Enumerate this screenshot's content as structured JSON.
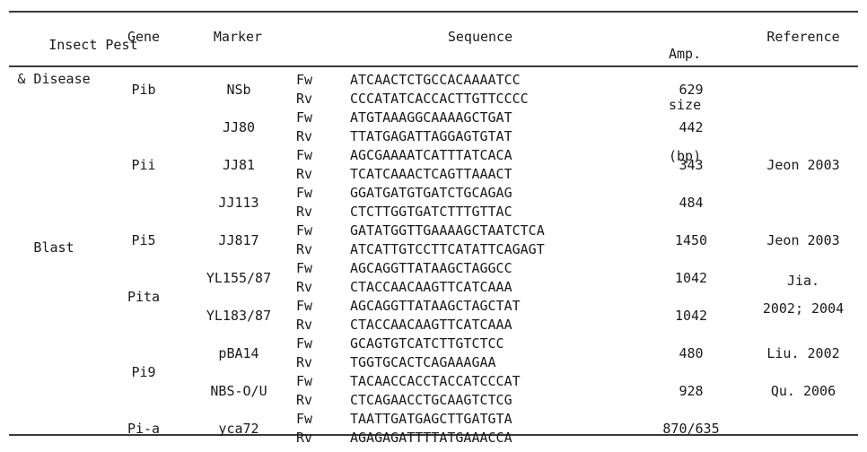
{
  "table": {
    "headers": {
      "pest_disease_line1": "Insect Pest",
      "pest_disease_line2": "& Disease",
      "gene": "Gene",
      "marker": "Marker",
      "sequence": "Sequence",
      "amp_size_line1": "Amp.",
      "amp_size_line2": "size",
      "amp_size_line3": "(bp)",
      "reference": "Reference"
    },
    "pest_disease": "Blast",
    "direction_labels": {
      "forward": "Fw",
      "reverse": "Rv"
    },
    "genes": [
      {
        "name": "Pib",
        "markers": [
          "NSb"
        ]
      },
      {
        "name": "Pii",
        "markers": [
          "JJ80",
          "JJ81",
          "JJ113"
        ]
      },
      {
        "name": "Pi5",
        "markers": [
          "JJ817"
        ]
      },
      {
        "name": "Pita",
        "markers": [
          "YL155/87",
          "YL183/87"
        ]
      },
      {
        "name": "Pi9",
        "markers": [
          "pBA14",
          "NBS-O/U"
        ]
      },
      {
        "name": "Pi-a",
        "markers": [
          "yca72"
        ]
      }
    ],
    "rows": [
      {
        "gene": "Pib",
        "marker": "NSb",
        "fw": "ATCAACTCTGCCACAAAATCC",
        "rv": "CCCATATCACCACTTGTTCCCC",
        "amp_size": "629",
        "reference": ""
      },
      {
        "gene": "Pii",
        "marker": "JJ80",
        "fw": "ATGTAAAGGCAAAAGCTGAT",
        "rv": "TTATGAGATTAGGAGTGTAT",
        "amp_size": "442",
        "reference": ""
      },
      {
        "gene": "Pii",
        "marker": "JJ81",
        "fw": "AGCGAAAATCATTTATCACA",
        "rv": "TCATCAAACTCAGTTAAACT",
        "amp_size": "343",
        "reference": "Jeon 2003"
      },
      {
        "gene": "Pii",
        "marker": "JJ113",
        "fw": "GGATGATGTGATCTGCAGAG",
        "rv": "CTCTTGGTGATCTTTGTTAC",
        "amp_size": "484",
        "reference": ""
      },
      {
        "gene": "Pi5",
        "marker": "JJ817",
        "fw": "GATATGGTTGAAAAGCTAATCTCA",
        "rv": "ATCATTGTCCTTCATATTCAGAGT",
        "amp_size": "1450",
        "reference": "Jeon 2003"
      },
      {
        "gene": "Pita",
        "marker": "YL155/87",
        "fw": "AGCAGGTTATAAGCTAGGCC",
        "rv": "CTACCAACAAGTTCATCAAA",
        "amp_size": "1042",
        "reference": "Jia. 2002; 2004"
      },
      {
        "gene": "Pita",
        "marker": "YL183/87",
        "fw": "AGCAGGTTATAAGCTAGCTAT",
        "rv": "CTACCAACAAGTTCATCAAA",
        "amp_size": "1042",
        "reference": ""
      },
      {
        "gene": "Pi9",
        "marker": "pBA14",
        "fw": "GCAGTGTCATCTTGTCTCC",
        "rv": "TGGTGCACTCAGAAAGAA",
        "amp_size": "480",
        "reference": "Liu. 2002"
      },
      {
        "gene": "Pi9",
        "marker": "NBS-O/U",
        "fw": "TACAACCACCTACCATCCCAT",
        "rv": "CTCAGAACCTGCAAGTCTCG",
        "amp_size": "928",
        "reference": "Qu. 2006"
      },
      {
        "gene": "Pi-a",
        "marker": "yca72",
        "fw": "TAATTGATGAGCTTGATGTA",
        "rv": "AGAGAGATTTTATGAAACCA",
        "amp_size": "870/635",
        "reference": ""
      }
    ],
    "references": [
      {
        "label": "Jeon 2003",
        "row_index": 2
      },
      {
        "label": "Jeon 2003",
        "row_index": 4
      },
      {
        "label": "Jia.",
        "row_index": 5
      },
      {
        "label": "2002; 2004",
        "row_index": 5
      },
      {
        "label": "Liu. 2002",
        "row_index": 7
      },
      {
        "label": "Qu. 2006",
        "row_index": 8
      }
    ]
  },
  "style": {
    "text_color": "#1a1a1a",
    "rule_color": "#3a3a3a",
    "background": "#ffffff"
  }
}
